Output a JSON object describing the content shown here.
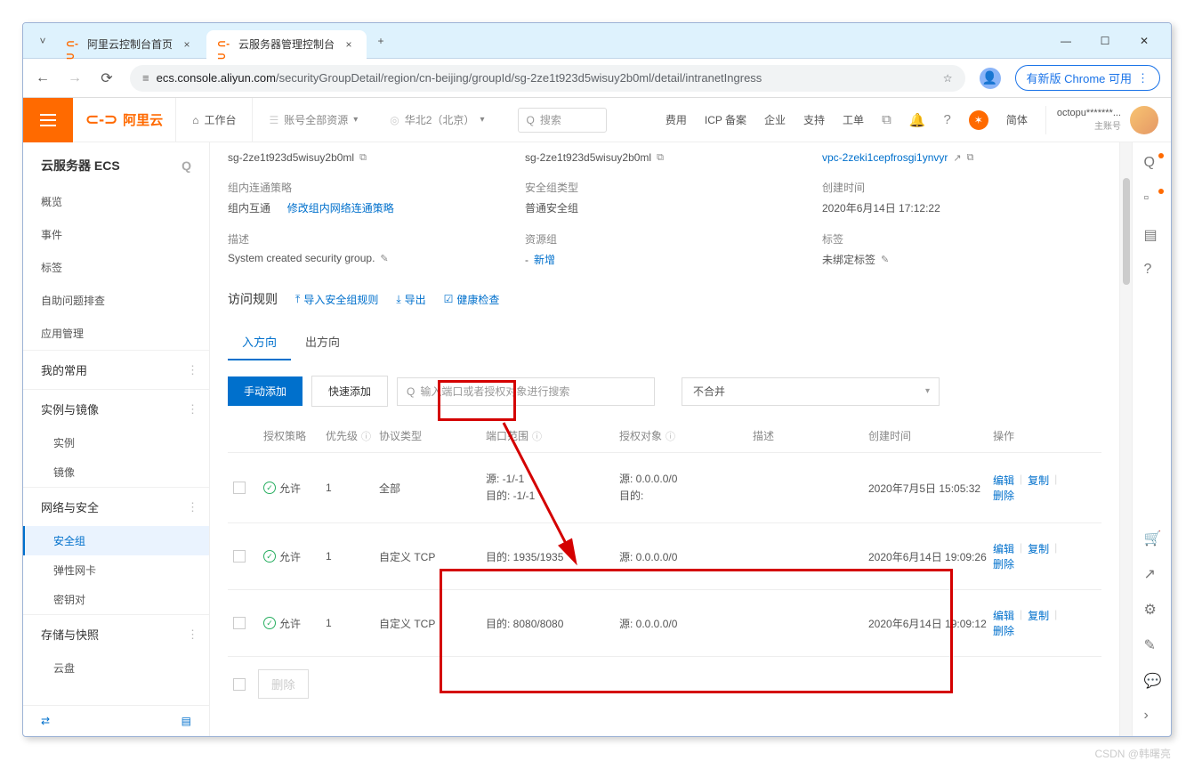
{
  "browser": {
    "tabs": [
      {
        "title": "阿里云控制台首页"
      },
      {
        "title": "云服务器管理控制台"
      }
    ],
    "url_lock": "⇆",
    "url_domain": "ecs.console.aliyun.com",
    "url_path": "/securityGroupDetail/region/cn-beijing/groupId/sg-2ze1t923d5wisuy2b0ml/detail/intranetIngress",
    "pill": "有新版 Chrome 可用"
  },
  "header": {
    "brand": "阿里云",
    "workbench": "工作台",
    "account_scope": "账号全部资源",
    "region": "华北2（北京）",
    "search_placeholder": "搜索",
    "links": [
      "费用",
      "ICP 备案",
      "企业",
      "支持",
      "工单"
    ],
    "lang": "简体",
    "user_name": "octopu*******...",
    "user_sub": "主账号"
  },
  "sidebar": {
    "title": "云服务器 ECS",
    "items_top": [
      "概览",
      "事件",
      "标签",
      "自助问题排查",
      "应用管理"
    ],
    "group_favorites": "我的常用",
    "group_instance": "实例与镜像",
    "subs_instance": [
      "实例",
      "镜像"
    ],
    "group_network": "网络与安全",
    "subs_network": [
      "安全组",
      "弹性网卡",
      "密钥对"
    ],
    "group_storage": "存储与快照",
    "subs_storage": [
      "云盘"
    ]
  },
  "details": {
    "sg_id": "sg-2ze1t923d5wisuy2b0ml",
    "sg_id2": "sg-2ze1t923d5wisuy2b0ml",
    "vpc_id": "vpc-2zeki1cepfrosgi1ynvyr",
    "policy_label": "组内连通策略",
    "policy_value": "组内互通",
    "policy_link": "修改组内网络连通策略",
    "type_label": "安全组类型",
    "type_value": "普通安全组",
    "created_label": "创建时间",
    "created_value": "2020年6月14日 17:12:22",
    "desc_label": "描述",
    "desc_value": "System created security group.",
    "resource_label": "资源组",
    "resource_link": "新增",
    "tag_label": "标签",
    "tag_value": "未绑定标签"
  },
  "rules": {
    "title": "访问规则",
    "actions": [
      "导入安全组规则",
      "导出",
      "健康检查"
    ],
    "tab_in": "入方向",
    "tab_out": "出方向",
    "add_btn": "手动添加",
    "quick_btn": "快速添加",
    "search_placeholder": "输入端口或者授权对象进行搜索",
    "merge_select": "不合并",
    "columns": {
      "policy": "授权策略",
      "priority": "优先级",
      "protocol": "协议类型",
      "port": "端口范围",
      "target": "授权对象",
      "desc": "描述",
      "created": "创建时间",
      "ops": "操作"
    },
    "rows": [
      {
        "allow": "允许",
        "priority": "1",
        "protocol": "全部",
        "port_src": "源: -1/-1",
        "port_dst": "目的: -1/-1",
        "target_src": "源: 0.0.0.0/0",
        "target_dst": "目的:",
        "desc": "",
        "created": "2020年7月5日 15:05:32"
      },
      {
        "allow": "允许",
        "priority": "1",
        "protocol": "自定义 TCP",
        "port_dst": "目的: 1935/1935",
        "target_src": "源: 0.0.0.0/0",
        "desc": "",
        "created": "2020年6月14日 19:09:26"
      },
      {
        "allow": "允许",
        "priority": "1",
        "protocol": "自定义 TCP",
        "port_dst": "目的: 8080/8080",
        "target_src": "源: 0.0.0.0/0",
        "desc": "",
        "created": "2020年6月14日 19:09:12"
      }
    ],
    "row_actions": {
      "edit": "编辑",
      "copy": "复制",
      "delete": "删除"
    },
    "delete_btn": "删除"
  },
  "watermark": "CSDN @韩曙亮"
}
